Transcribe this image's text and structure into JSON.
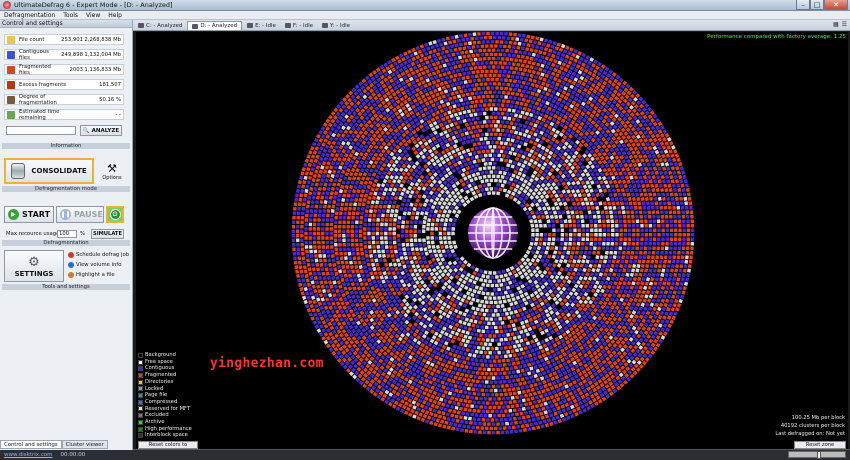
{
  "window": {
    "title": "UltimateDefrag 6 - Expert Mode - [D: - Analyzed]",
    "min": "–",
    "max": "□",
    "close": "✕"
  },
  "menu": [
    "Defragmentation",
    "Tools",
    "View",
    "Help"
  ],
  "left_panel": {
    "header": "Control and settings",
    "stats": [
      {
        "label": "File count",
        "v1": "253,901",
        "v2": "2,268,838 Mb",
        "color": "#e6c84a"
      },
      {
        "label": "Contiguous files",
        "v1": "249,898",
        "v2": "1,132,004 Mb",
        "color": "#3a53d0"
      },
      {
        "label": "Fragmented files",
        "v1": "2003",
        "v2": "1,136,833 Mb",
        "color": "#d8451e"
      },
      {
        "label": "Excess fragments",
        "v1": "",
        "v2": "181,507",
        "color": "#b3361a"
      },
      {
        "label": "Degree of fragmentation",
        "v1": "",
        "v2": "50.16 %",
        "color": "#7a5a3a"
      },
      {
        "label": "Estimated time remaining",
        "v1": "",
        "v2": "- -",
        "color": "#6aa84f"
      }
    ],
    "analyze_label": "ANALYZE",
    "info_caption": "Information",
    "consolidate_label": "CONSOLIDATE",
    "options_label": "Options",
    "mode_caption": "Defragmentation mode",
    "start_label": "START",
    "pause_label": "PAUSE",
    "max_resource_label": "Max recource usage:",
    "max_resource_value": "100",
    "percent": "%",
    "simulate_label": "SIMULATE",
    "defrag_caption": "Defragmentation",
    "settings_label": "SETTINGS",
    "tools": [
      {
        "label": "Schedule defrag job",
        "color": "#d23a2a"
      },
      {
        "label": "View volume info",
        "color": "#2a6ad2"
      },
      {
        "label": "Highlight a file",
        "color": "#d27a2a"
      }
    ],
    "tools_caption": "Tools and settings",
    "bottom_tabs": [
      "Control and settings",
      "Cluster viewer"
    ]
  },
  "tabs": [
    {
      "label": "C: - Analyzed",
      "active": false
    },
    {
      "label": "D: - Analyzed",
      "active": true
    },
    {
      "label": "E: - Idle",
      "active": false
    },
    {
      "label": "F: - Idle",
      "active": false
    },
    {
      "label": "Y: - Idle",
      "active": false
    }
  ],
  "viewport": {
    "performance": "Performance compared with factory average: 1.25",
    "legend": [
      {
        "label": "Background",
        "color": "#000000"
      },
      {
        "label": "Free space",
        "color": "#ffffff"
      },
      {
        "label": "Contiguous",
        "color": "#3b2ad6"
      },
      {
        "label": "Fragmented",
        "color": "#e0421c"
      },
      {
        "label": "Directories",
        "color": "#e8c84a"
      },
      {
        "label": "Locked",
        "color": "#9a9a9a"
      },
      {
        "label": "Page file",
        "color": "#1aa3a3"
      },
      {
        "label": "Compressed",
        "color": "#3a7ad6"
      },
      {
        "label": "Reserved for MFT",
        "color": "#d8d8d8"
      },
      {
        "label": "Excluded",
        "color": "#7a7a7a"
      },
      {
        "label": "Archive",
        "color": "#2ad62a"
      },
      {
        "label": "High performance",
        "color": "#1a8a1a"
      },
      {
        "label": "Interblock space",
        "color": "#303030"
      }
    ],
    "reset_colors": "Reset colors to default",
    "stats": [
      "100.25 Mb per block",
      "40192 clusters per block",
      "Last defragged on: Not yet"
    ],
    "reset_zone": "Reset zone positions",
    "watermark": "yinghezhan.com"
  },
  "statusbar": {
    "link": "www.disktrix.com",
    "time": "00:00:00"
  }
}
